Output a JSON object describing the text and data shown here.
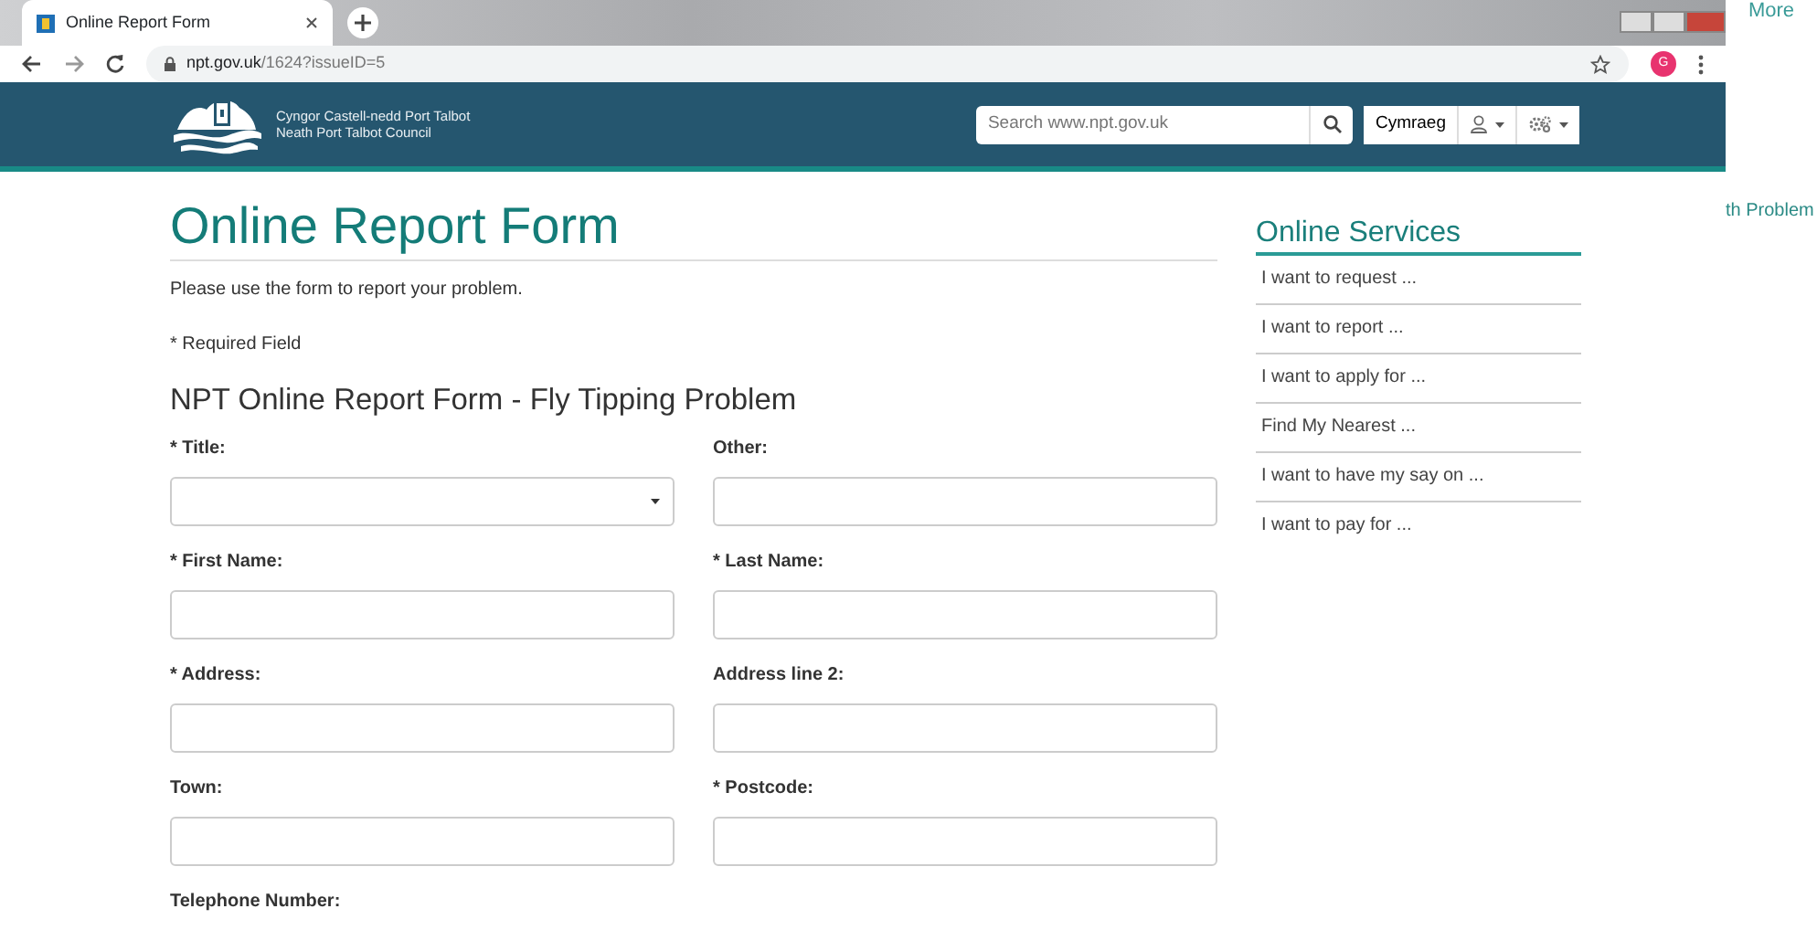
{
  "browser": {
    "tab_title": "Online Report Form",
    "url_domain": "npt.gov.uk",
    "url_path": "/1624?issueID=5",
    "profile_initial": "G"
  },
  "outside": {
    "top_text": "More",
    "side_text": "th Problem"
  },
  "header": {
    "name_welsh": "Cyngor Castell-nedd Port Talbot",
    "name_english": "Neath Port Talbot Council",
    "search": {
      "placeholder": "Search www.npt.gov.uk"
    },
    "language": "Cymraeg"
  },
  "main": {
    "heading": "Online Report Form",
    "intro": "Please use the form to report your problem.",
    "required_note": "* Required Field",
    "form_title": "NPT Online Report Form - Fly Tipping Problem",
    "fields": [
      {
        "label": "* Title:",
        "kind": "select"
      },
      {
        "label": "Other:",
        "kind": "text"
      },
      {
        "label": "* First Name:",
        "kind": "text"
      },
      {
        "label": "* Last Name:",
        "kind": "text"
      },
      {
        "label": "* Address:",
        "kind": "text"
      },
      {
        "label": "Address line 2:",
        "kind": "text"
      },
      {
        "label": "Town:",
        "kind": "text"
      },
      {
        "label": "* Postcode:",
        "kind": "text"
      },
      {
        "label": "Telephone Number:",
        "kind": "label"
      }
    ]
  },
  "sidebar": {
    "title": "Online Services",
    "items": [
      "I want to request ...",
      "I want to report ...",
      "I want to apply for ...",
      "Find My Nearest ...",
      "I want to have my say on ...",
      "I want to pay for ..."
    ]
  }
}
